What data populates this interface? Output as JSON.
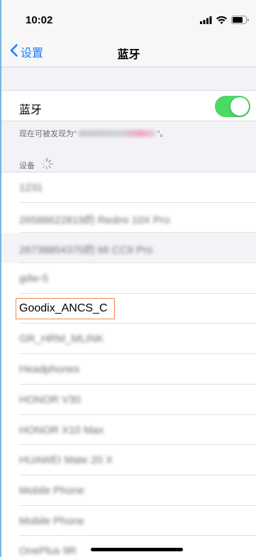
{
  "status_bar": {
    "time": "10:02",
    "icons": [
      "cellular-signal-icon",
      "wifi-icon",
      "battery-icon"
    ]
  },
  "nav": {
    "back_label": "设置",
    "title": "蓝牙"
  },
  "bluetooth": {
    "label": "蓝牙",
    "enabled": true,
    "toggle_color": "#4cd964"
  },
  "discoverable": {
    "prefix": "现在可被发现为“",
    "suffix": "”。"
  },
  "devices_section": {
    "header": "设备"
  },
  "devices": [
    {
      "name": "1231"
    },
    {
      "name": "26588622819的 Redmi 10X Pro"
    },
    {
      "name": "26738854370的 Mi CC9 Pro"
    },
    {
      "name": "gdw-5"
    },
    {
      "name": "Goodix_ANCS_C"
    },
    {
      "name": "GR_HRM_MLINK"
    },
    {
      "name": "Headphones"
    },
    {
      "name": "HONOR V30"
    },
    {
      "name": "HONOR X10 Max"
    },
    {
      "name": "HUAWEI Mate 20 X"
    },
    {
      "name": "Mobile Phone"
    },
    {
      "name": "Mobile Phone"
    },
    {
      "name": "OnePlus 9R"
    }
  ],
  "colors": {
    "accent": "#147efb",
    "highlight_border": "#ef8a50"
  }
}
